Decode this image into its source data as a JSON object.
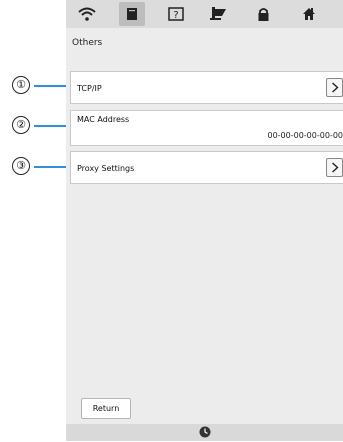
{
  "callouts": [
    "①",
    "②",
    "③"
  ],
  "toolbar": {
    "icons": [
      "wifi-icon",
      "document-icon",
      "help-icon",
      "sewing-machine-icon",
      "lock-icon",
      "home-icon"
    ],
    "active_index": 1
  },
  "section_title": "Others",
  "rows": {
    "tcpip_label": "TCP/IP",
    "mac_label": "MAC Address",
    "mac_value": "00-00-00-00-00-00",
    "proxy_label": "Proxy Settings"
  },
  "return_label": "Return",
  "bottom_icon": "clock-icon",
  "colors": {
    "callout_line": "#2f8fd8",
    "screen_bg": "#ececec",
    "topbar_bg": "#dcdcdc"
  }
}
